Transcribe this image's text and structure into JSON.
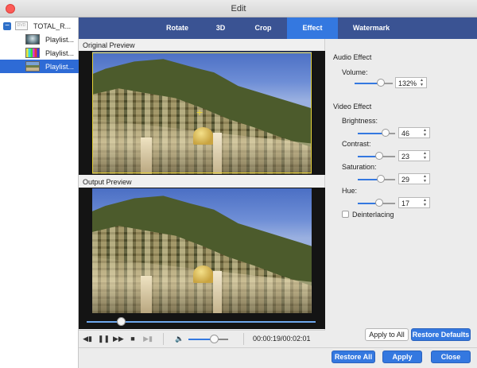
{
  "window": {
    "title": "Edit"
  },
  "sidebar": {
    "root": {
      "label": "TOTAL_R...",
      "folder_icon": "dvd-folder-icon",
      "collapse_icon": "minus-icon"
    },
    "items": [
      {
        "label": "Playlist...",
        "selected": false
      },
      {
        "label": "Playlist...",
        "selected": false
      },
      {
        "label": "Playlist...",
        "selected": true
      }
    ]
  },
  "tabs": [
    {
      "label": "Rotate",
      "active": false
    },
    {
      "label": "3D",
      "active": false
    },
    {
      "label": "Crop",
      "active": false
    },
    {
      "label": "Effect",
      "active": true
    },
    {
      "label": "Watermark",
      "active": false
    }
  ],
  "preview": {
    "original_label": "Original Preview",
    "output_label": "Output Preview",
    "seek_progress": 0.158
  },
  "controls": {
    "time_display": "00:00:19/00:02:01",
    "volume_level": 0.66
  },
  "audio_effect": {
    "title": "Audio Effect",
    "volume_label": "Volume:",
    "volume_value": "132%"
  },
  "video_effect": {
    "title": "Video Effect",
    "brightness_label": "Brightness:",
    "brightness_value": "46",
    "contrast_label": "Contrast:",
    "contrast_value": "23",
    "saturation_label": "Saturation:",
    "saturation_value": "29",
    "hue_label": "Hue:",
    "hue_value": "17",
    "deinterlacing_label": "Deinterlacing",
    "deinterlacing_checked": false
  },
  "buttons": {
    "apply_to_all": "Apply to All",
    "restore_defaults": "Restore Defaults",
    "restore_all": "Restore All",
    "apply": "Apply",
    "close": "Close"
  },
  "colors": {
    "accent": "#3478e0",
    "tabbar": "#3a5393",
    "selection_box": "#e8d43a"
  }
}
